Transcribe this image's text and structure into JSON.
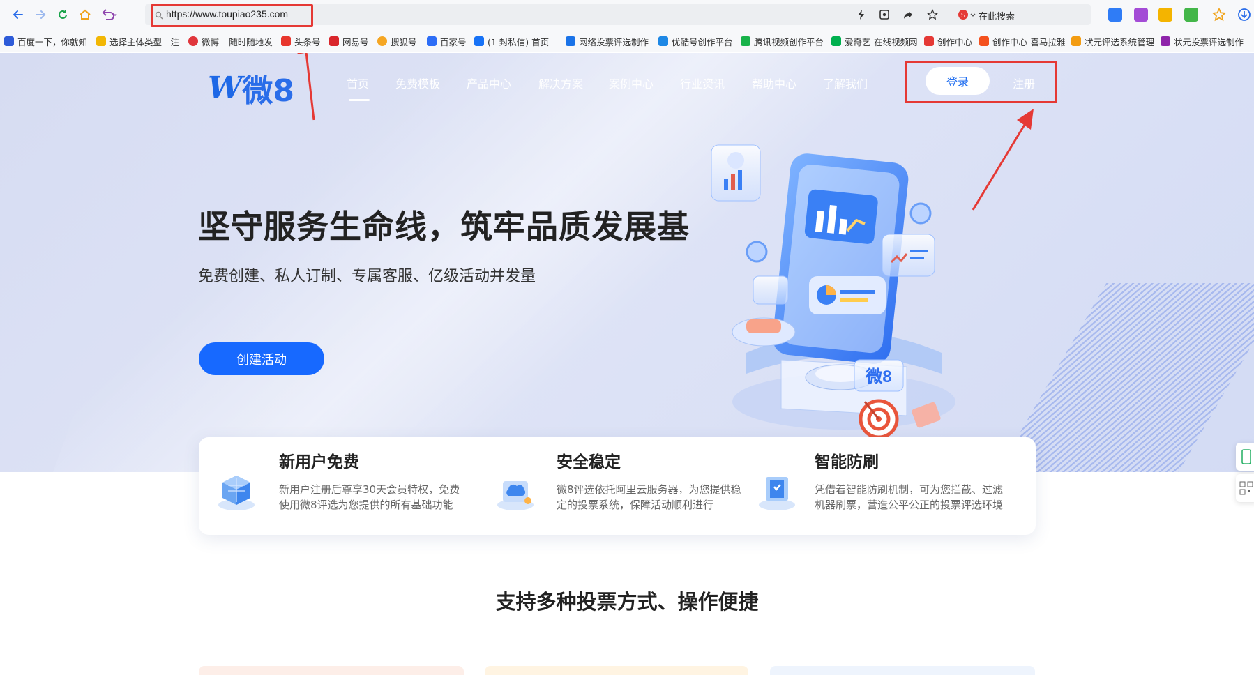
{
  "browser": {
    "url": "https://www.toupiao235.com",
    "search_label": "在此搜索",
    "nav_icons": [
      "back-arrow-icon",
      "forward-arrow-icon",
      "refresh-icon",
      "home-icon",
      "undo-icon"
    ],
    "tool_icons": [
      "lightning-icon",
      "screenshot-icon",
      "share-icon",
      "star-icon"
    ]
  },
  "bookmarks": [
    {
      "label": "百度一下，你就知",
      "color": "#2e5bd8"
    },
    {
      "label": "选择主体类型 - 注",
      "color": "#f2b705"
    },
    {
      "label": "微博 – 随时随地发",
      "color": "#e0363c"
    },
    {
      "label": "头条号",
      "color": "#e8362d"
    },
    {
      "label": "网易号",
      "color": "#d9262c"
    },
    {
      "label": "搜狐号",
      "color": "#f5a623"
    },
    {
      "label": "百家号",
      "color": "#2d6df6"
    },
    {
      "label": "(1 封私信) 首页 -",
      "color": "#1772f6"
    },
    {
      "label": "网络投票评选制作",
      "color": "#1a73e8"
    },
    {
      "label": "优酷号创作平台",
      "color": "#1e88e5"
    },
    {
      "label": "腾讯视频创作平台",
      "color": "#18b34a"
    },
    {
      "label": "爱奇艺-在线视频网",
      "color": "#00b04f"
    },
    {
      "label": "创作中心",
      "color": "#e53935"
    },
    {
      "label": "创作中心-喜马拉雅",
      "color": "#f4511e"
    },
    {
      "label": "状元评选系统管理",
      "color": "#f39c12"
    },
    {
      "label": "状元投票评选制作",
      "color": "#8e24aa"
    }
  ],
  "site": {
    "logo_text": "微8",
    "nav": [
      "首页",
      "免费模板",
      "产品中心",
      "解决方案",
      "案例中心",
      "行业资讯",
      "帮助中心",
      "了解我们"
    ],
    "login": "登录",
    "register": "注册"
  },
  "hero": {
    "title": "坚守服务生命线，筑牢品质发展基",
    "subtitle": "免费创建、私人订制、专属客服、亿级活动并发量",
    "cta": "创建活动",
    "illustration_badge": "微8"
  },
  "features": [
    {
      "title": "新用户免费",
      "desc": "新用户注册后尊享30天会员特权，免费使用微8评选为您提供的所有基础功能",
      "icon": "cube-stack-icon"
    },
    {
      "title": "安全稳定",
      "desc": "微8评选依托阿里云服务器，为您提供稳定的投票系统，保障活动顺利进行",
      "icon": "cloud-server-icon"
    },
    {
      "title": "智能防刷",
      "desc": "凭借着智能防刷机制，可为您拦截、过滤机器刷票，营造公平公正的投票评选环境",
      "icon": "shield-screen-icon"
    }
  ],
  "section_title": "支持多种投票方式、操作便捷",
  "colors": {
    "primary": "#1769ff",
    "highlight": "#e53935"
  }
}
